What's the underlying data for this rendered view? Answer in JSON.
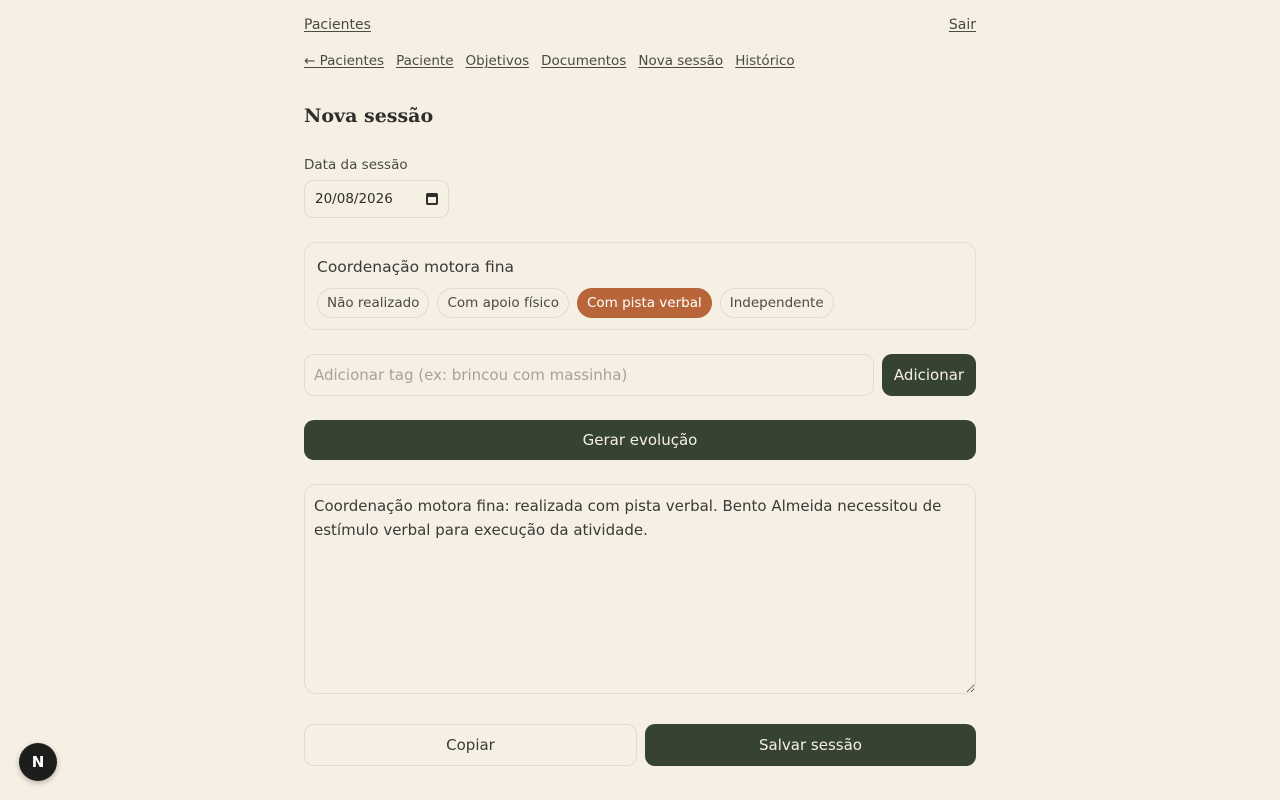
{
  "topbar": {
    "patients_link": "Pacientes",
    "logout_link": "Sair"
  },
  "subnav": {
    "items": [
      {
        "label": "← Pacientes"
      },
      {
        "label": "Paciente"
      },
      {
        "label": "Objetivos"
      },
      {
        "label": "Documentos"
      },
      {
        "label": "Nova sessão"
      },
      {
        "label": "Histórico"
      }
    ]
  },
  "page": {
    "title": "Nova sessão"
  },
  "session_date": {
    "label": "Data da sessão",
    "value": "20/08/2026"
  },
  "goal": {
    "title": "Coordenação motora fina",
    "options": [
      {
        "label": "Não realizado"
      },
      {
        "label": "Com apoio físico"
      },
      {
        "label": "Com pista verbal",
        "selected": true
      },
      {
        "label": "Independente"
      }
    ]
  },
  "tag": {
    "placeholder": "Adicionar tag (ex: brincou com massinha)",
    "add_label": "Adicionar"
  },
  "actions": {
    "generate_label": "Gerar evolução",
    "copy_label": "Copiar",
    "save_label": "Salvar sessão"
  },
  "evolution": {
    "text": "Coordenação motora fina: realizada com pista verbal. Bento Almeida necessitou de estímulo verbal para execução da atividade."
  },
  "dev_badge": {
    "letter": "N"
  },
  "colors": {
    "background": "#f5efe4",
    "primary": "#374332",
    "accent": "#b8653a"
  }
}
